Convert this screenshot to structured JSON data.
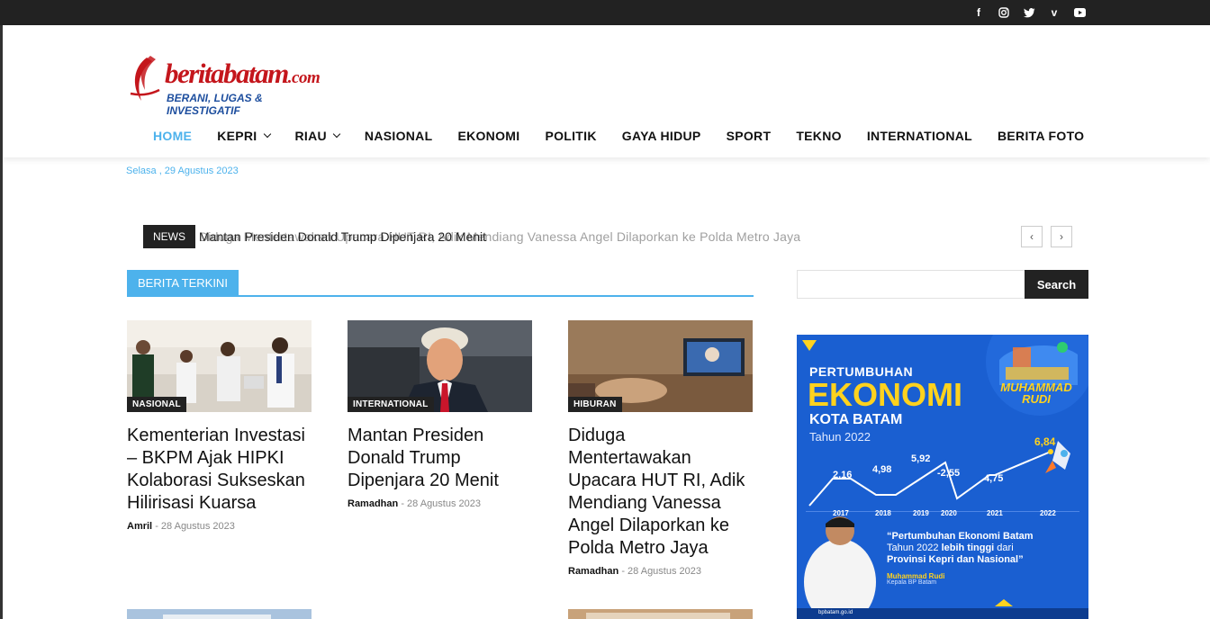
{
  "social": {
    "icons": [
      "facebook-icon",
      "instagram-icon",
      "twitter-icon",
      "vimeo-icon",
      "youtube-icon"
    ]
  },
  "logo": {
    "name": "beritabatam",
    "tld": ".com",
    "tagline": "BERANI, LUGAS & INVESTIGATIF"
  },
  "nav": {
    "items": [
      {
        "label": "HOME",
        "active": true
      },
      {
        "label": "KEPRI",
        "dropdown": true
      },
      {
        "label": "RIAU",
        "dropdown": true
      },
      {
        "label": "NASIONAL"
      },
      {
        "label": "EKONOMI"
      },
      {
        "label": "POLITIK"
      },
      {
        "label": "GAYA HIDUP"
      },
      {
        "label": "SPORT"
      },
      {
        "label": "TEKNO"
      },
      {
        "label": "INTERNATIONAL"
      },
      {
        "label": "BERITA FOTO"
      }
    ]
  },
  "date": "Selasa , 29 Agustus 2023",
  "ticker": {
    "label": "NEWS",
    "headline": "Mantan Presiden Donald Trump Dipenjara 20 Menit",
    "overlap_headline": "Diduga Mentertawakan Upacara HUT RI, Adik Mendiang Vanessa Angel Dilaporkan ke Polda Metro Jaya",
    "prev": "‹",
    "next": "›"
  },
  "section": {
    "title": "BERITA TERKINI"
  },
  "articles": [
    {
      "category": "NASIONAL",
      "title": "Kementerian Investasi – BKPM Ajak HIPKI Kolaborasi Sukseskan Hilirisasi Kuarsa",
      "author": "Amril",
      "date": "28 Agustus 2023"
    },
    {
      "category": "INTERNATIONAL",
      "title": "Mantan Presiden Donald Trump Dipenjara 20 Menit",
      "author": "Ramadhan",
      "date": "28 Agustus 2023"
    },
    {
      "category": "HIBURAN",
      "title": "Diduga Mentertawakan Upacara HUT RI, Adik Mendiang Vanessa Angel Dilaporkan ke Polda Metro Jaya",
      "author": "Ramadhan",
      "date": "28 Agustus 2023"
    }
  ],
  "search": {
    "placeholder": "",
    "button": "Search"
  },
  "ad": {
    "line1": "PERTUMBUHAN",
    "line2": "EKONOMI",
    "line3": "KOTA BATAM",
    "line4": "Tahun 2022",
    "name_badge": "MUHAMMAD RUDI",
    "growth": [
      {
        "year": "2017",
        "value": "2,16"
      },
      {
        "year": "2018",
        "value": "4,98"
      },
      {
        "year": "2019",
        "value": "5,92"
      },
      {
        "year": "2020",
        "value": "-2,55"
      },
      {
        "year": "2021",
        "value": "4,75"
      },
      {
        "year": "2022",
        "value": "6,84"
      }
    ],
    "quote_a": "“Pertumbuhan Ekonomi Batam",
    "quote_b": "Tahun 2022",
    "quote_c": "lebih tinggi",
    "quote_d": "dari",
    "quote_e": "Provinsi Kepri dan Nasional”",
    "signature": "Muhammad Rudi",
    "signature_title": "Kepala BP Batam",
    "site": "bpbatam.go.id"
  }
}
